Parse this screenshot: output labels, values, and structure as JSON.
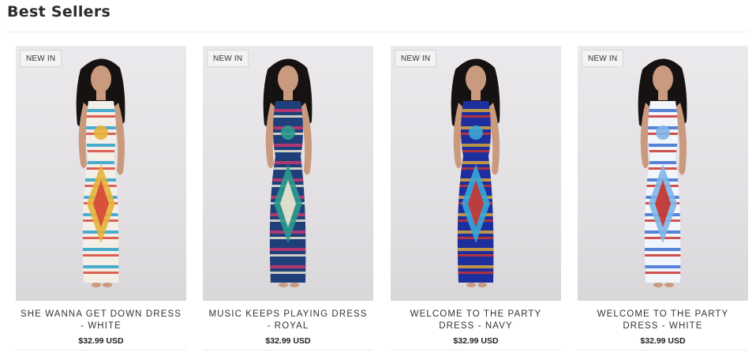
{
  "section": {
    "title": "Best Sellers"
  },
  "products": [
    {
      "badge": "NEW IN",
      "name": "SHE WANNA GET DOWN DRESS - WHITE",
      "price": "$32.99 USD",
      "palette": {
        "base": "#f4efe6",
        "a": "#2aa0c8",
        "b": "#d8463a",
        "c": "#e6b23a"
      }
    },
    {
      "badge": "NEW IN",
      "name": "MUSIC KEEPS PLAYING DRESS - ROYAL",
      "price": "$32.99 USD",
      "palette": {
        "base": "#1f3f7a",
        "a": "#c8376e",
        "b": "#f0e6d2",
        "c": "#2b9a8e"
      }
    },
    {
      "badge": "NEW IN",
      "name": "WELCOME TO THE PARTY DRESS - NAVY",
      "price": "$32.99 USD",
      "palette": {
        "base": "#1d2f9e",
        "a": "#d8a73a",
        "b": "#c8342e",
        "c": "#3aa6d8"
      }
    },
    {
      "badge": "NEW IN",
      "name": "WELCOME TO THE PARTY DRESS - WHITE",
      "price": "$32.99 USD",
      "palette": {
        "base": "#f2f5fb",
        "a": "#3b6fd0",
        "b": "#c8342e",
        "c": "#7fb6e8"
      }
    }
  ]
}
